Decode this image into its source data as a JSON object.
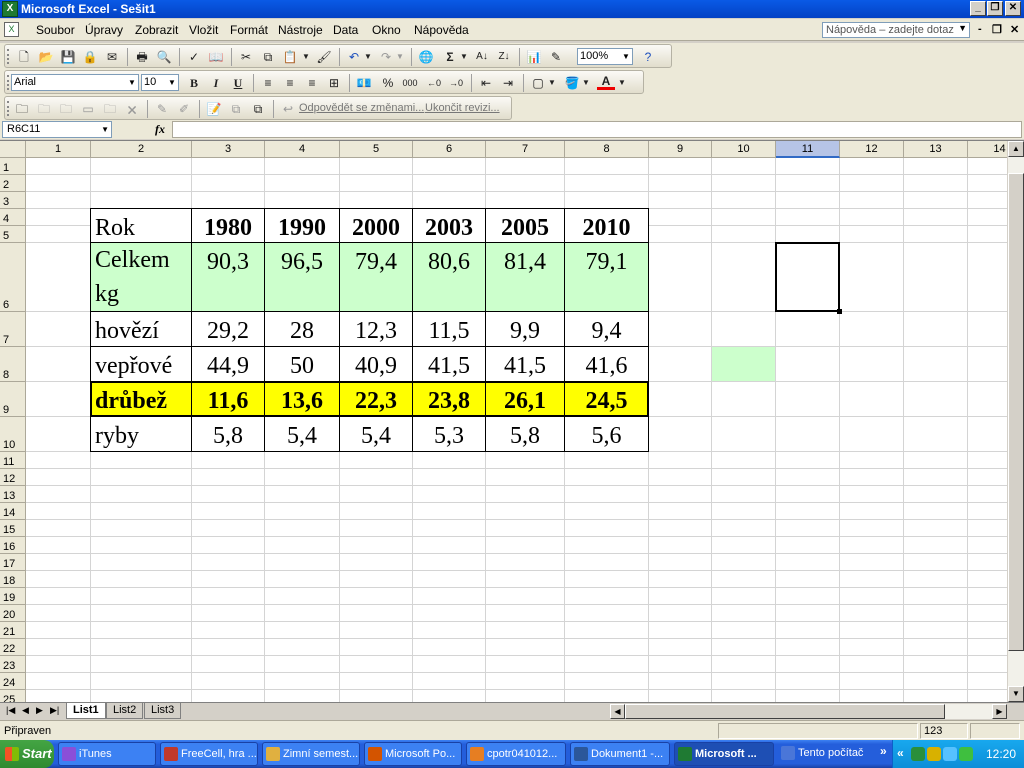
{
  "window": {
    "title": "Microsoft Excel - Sešit1"
  },
  "menu": {
    "items": [
      "Soubor",
      "Úpravy",
      "Zobrazit",
      "Vložit",
      "Formát",
      "Nástroje",
      "Data",
      "Okno",
      "Nápověda"
    ],
    "help_placeholder": "Nápověda – zadejte dotaz"
  },
  "toolbar": {
    "zoom": "100%",
    "font_name": "Arial",
    "font_size": "10",
    "bold": "B",
    "italic": "I",
    "underline": "U",
    "percent": "%",
    "thousands": "000",
    "reply_changes": "Odpovědět se změnami...",
    "end_review": "Ukončit revizi..."
  },
  "formula": {
    "name_box": "R6C11",
    "fx": "fx",
    "value": ""
  },
  "grid": {
    "columns": [
      "1",
      "2",
      "3",
      "4",
      "5",
      "6",
      "7",
      "8",
      "9",
      "10",
      "11",
      "12",
      "13",
      "14"
    ],
    "rows": [
      "1",
      "2",
      "3",
      "4",
      "5",
      "6",
      "7",
      "8",
      "9",
      "10",
      "11",
      "12",
      "13",
      "14",
      "15",
      "16",
      "17",
      "18",
      "19",
      "20",
      "21",
      "22",
      "23",
      "24",
      "25"
    ],
    "selected_column": "11"
  },
  "table": {
    "header": [
      "Rok",
      "1980",
      "1990",
      "2000",
      "2003",
      "2005",
      "2010"
    ],
    "rows": [
      {
        "label": "Celkem kg",
        "values": [
          "90,3",
          "96,5",
          "79,4",
          "80,6",
          "81,4",
          "79,1"
        ]
      },
      {
        "label": "hovězí",
        "values": [
          "29,2",
          "28",
          "12,3",
          "11,5",
          "9,9",
          "9,4"
        ]
      },
      {
        "label": "vepřové",
        "values": [
          "44,9",
          "50",
          "40,9",
          "41,5",
          "41,5",
          "41,6"
        ]
      },
      {
        "label": "drůbež",
        "values": [
          "11,6",
          "13,6",
          "22,3",
          "23,8",
          "26,1",
          "24,5"
        ]
      },
      {
        "label": "ryby",
        "values": [
          "5,8",
          "5,4",
          "5,4",
          "5,3",
          "5,8",
          "5,6"
        ]
      }
    ]
  },
  "colors": {
    "green_fill": "#ccffcc",
    "yellow_fill": "#ffff00",
    "selection": "#000000"
  },
  "sheets": {
    "tabs": [
      "List1",
      "List2",
      "List3"
    ],
    "active": "List1"
  },
  "status": {
    "text": "Připraven",
    "count": "123"
  },
  "taskbar": {
    "start": "Start",
    "items": [
      "iTunes",
      "FreeCell, hra ...",
      "Zimní semest...",
      "Microsoft Po...",
      "cpotr041012...",
      "Dokument1 -...",
      "Microsoft ...",
      "Tento počítač"
    ],
    "active_index": 6,
    "clock": "12:20"
  }
}
